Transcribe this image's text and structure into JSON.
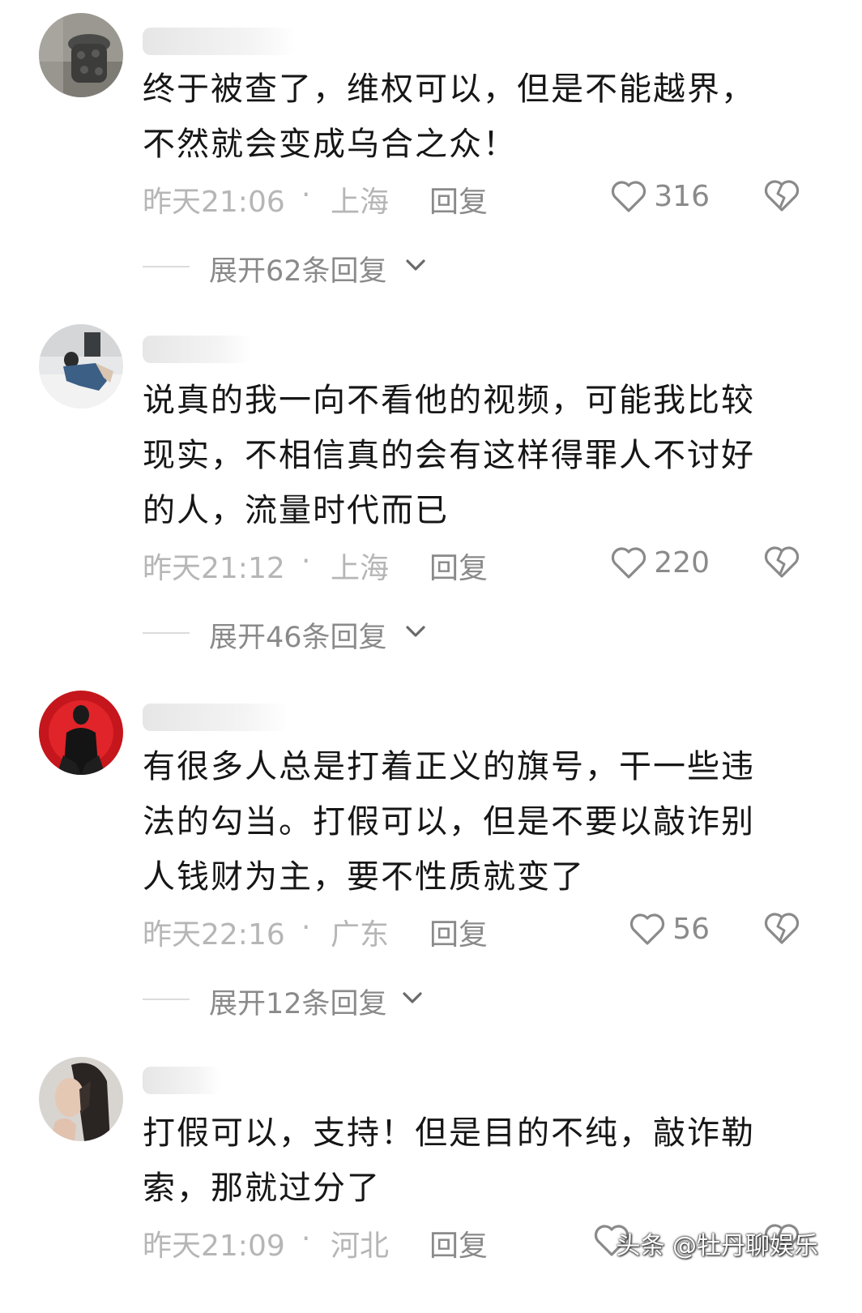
{
  "comments": [
    {
      "text_lines": [
        "终于被查了，维权可以，但是不能越界，",
        "不然就会变成乌合之众！"
      ],
      "time": "昨天21:06",
      "dot": "·",
      "location": "上海",
      "reply_label": "回复",
      "likes": "316",
      "expand_label": "展开62条回复"
    },
    {
      "text_lines": [
        "说真的我一向不看他的视频，可能我比较",
        "现实，不相信真的会有这样得罪人不讨好",
        "的人，流量时代而已"
      ],
      "time": "昨天21:12",
      "dot": "·",
      "location": "上海",
      "reply_label": "回复",
      "likes": "220",
      "expand_label": "展开46条回复"
    },
    {
      "text_lines": [
        "有很多人总是打着正义的旗号，干一些违",
        "法的勾当。打假可以，但是不要以敲诈别",
        "人钱财为主，要不性质就变了"
      ],
      "time": "昨天22:16",
      "dot": "·",
      "location": "广东",
      "reply_label": "回复",
      "likes": "56",
      "expand_label": "展开12条回复"
    },
    {
      "text_lines": [
        "打假可以，支持！但是目的不纯，敲诈勒",
        "索，那就过分了"
      ],
      "time": "昨天21:09",
      "dot": "·",
      "location": "河北",
      "reply_label": "回复"
    }
  ],
  "watermark": "头条 @牡丹聊娱乐",
  "icons": {
    "like": "heart-outline-icon",
    "dislike": "broken-heart-icon",
    "expand": "chevron-down-icon"
  },
  "colors": {
    "text": "#161616",
    "meta": "#b6b6b6",
    "secondary": "#8a8a8a"
  }
}
